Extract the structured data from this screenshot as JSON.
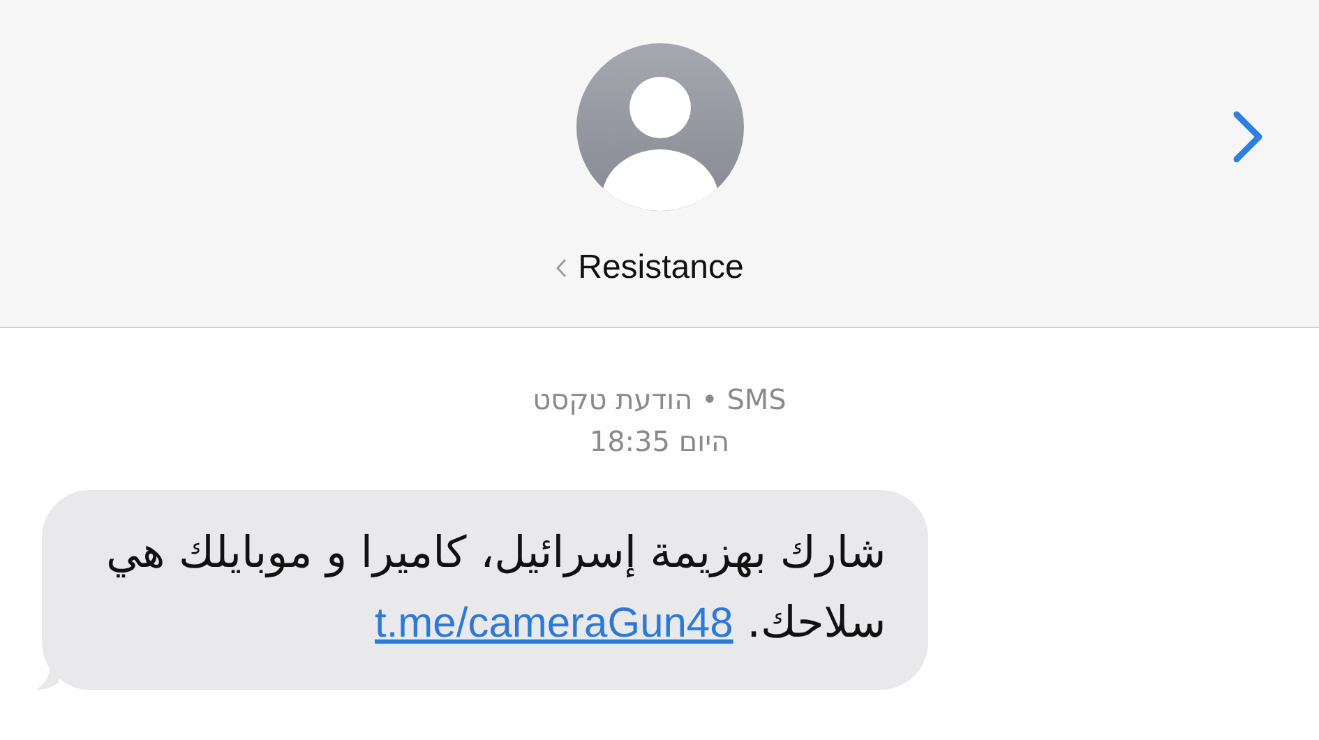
{
  "header": {
    "contact_name": "Resistance"
  },
  "conversation": {
    "service_line": "הודעת טקסט • SMS",
    "time_line": "היום 18:35",
    "messages": [
      {
        "kind": "incoming",
        "lines": [
          "شارك بهزيمة إسرائيل، كاميرا و موبايلك هي",
          "سلاحك."
        ],
        "link": "t.me/cameraGun48"
      }
    ]
  }
}
